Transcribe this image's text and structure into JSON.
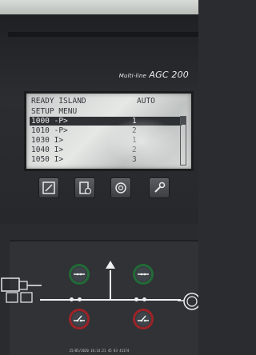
{
  "brand": {
    "prefix": "Multi-line",
    "model": "AGC 200"
  },
  "screen": {
    "status_title": "READY ISLAND",
    "mode": "AUTO",
    "menu_title": "SETUP MENU",
    "rows": [
      {
        "label": "1000 -P>",
        "value": "1",
        "selected": true
      },
      {
        "label": "1010 -P>",
        "value": "2",
        "selected": false
      },
      {
        "label": "1030 I>",
        "value": "1",
        "selected": false
      },
      {
        "label": "1040 I>",
        "value": "2",
        "selected": false
      },
      {
        "label": "1050 I>",
        "value": "3",
        "selected": false
      }
    ]
  },
  "function_buttons": [
    {
      "icon": "edit-icon"
    },
    {
      "icon": "log-icon"
    },
    {
      "icon": "settings-icon"
    },
    {
      "icon": "tool-icon"
    }
  ],
  "breakers": [
    {
      "name": "genset-breaker-close",
      "state": "close"
    },
    {
      "name": "genset-breaker-open",
      "state": "open"
    },
    {
      "name": "mains-breaker-close",
      "state": "close"
    },
    {
      "name": "mains-breaker-open",
      "state": "open"
    }
  ],
  "colors": {
    "close_ring": "#1f6e37",
    "open_ring": "#a02428",
    "lcd_bg": "#d7dad8"
  },
  "timestamp": "25/05/2020 16:14:21 45 83 41174"
}
